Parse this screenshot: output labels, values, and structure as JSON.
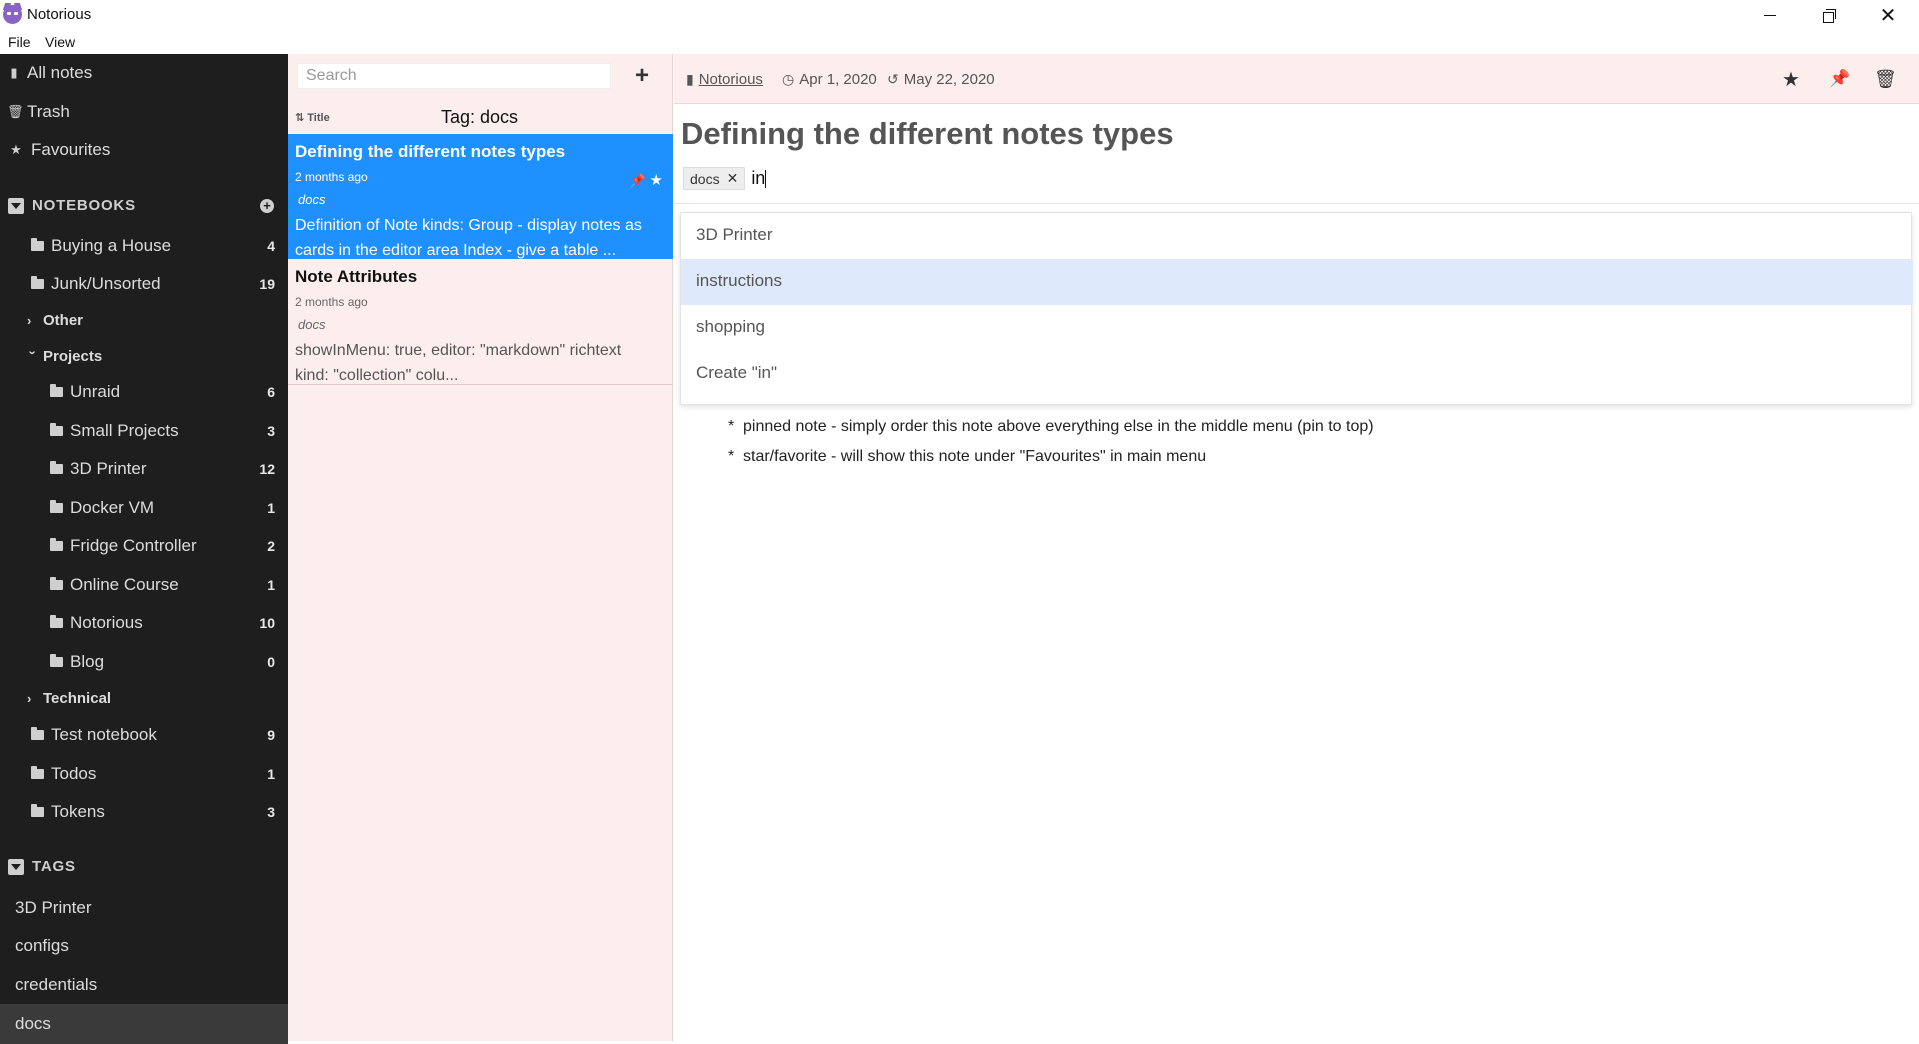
{
  "window": {
    "title": "Notorious"
  },
  "menu": {
    "file": "File",
    "view": "View"
  },
  "sidebar": {
    "all_notes": "All notes",
    "trash": "Trash",
    "favourites": "Favourites",
    "notebooks_header": "NOTEBOOKS",
    "tags_header": "TAGS",
    "notebooks": [
      {
        "label": "Buying a House",
        "count": "4"
      },
      {
        "label": "Junk/Unsorted",
        "count": "19"
      },
      {
        "label": "Other"
      },
      {
        "label": "Projects"
      },
      {
        "label": "Unraid",
        "count": "6"
      },
      {
        "label": "Small Projects",
        "count": "3"
      },
      {
        "label": "3D Printer",
        "count": "12"
      },
      {
        "label": "Docker VM",
        "count": "1"
      },
      {
        "label": "Fridge Controller",
        "count": "2"
      },
      {
        "label": "Online Course",
        "count": "1"
      },
      {
        "label": "Notorious",
        "count": "10"
      },
      {
        "label": "Blog",
        "count": "0"
      },
      {
        "label": "Technical"
      },
      {
        "label": "Test notebook",
        "count": "9"
      },
      {
        "label": "Todos",
        "count": "1"
      },
      {
        "label": "Tokens",
        "count": "3"
      }
    ],
    "tags": [
      "3D Printer",
      "configs",
      "credentials",
      "docs"
    ]
  },
  "notelist": {
    "search_placeholder": "Search",
    "sort_label": "Title",
    "header": "Tag: docs",
    "notes": [
      {
        "title": "Defining the different notes types",
        "date": "2 months ago",
        "tag": "docs",
        "excerpt": "Definition of Note kinds: Group - display notes as cards in the editor area Index - give a table ..."
      },
      {
        "title": "Note Attributes",
        "date": "2 months ago",
        "tag": "docs",
        "excerpt": "showInMenu: true, editor: \"markdown\" richtext kind: \"collection\" colu..."
      }
    ]
  },
  "editor": {
    "notebook": "Notorious",
    "created": "Apr 1, 2020",
    "updated": "May 22, 2020",
    "title": "Defining the different notes types",
    "tag_chip": "docs",
    "tag_input": "in",
    "suggestions": [
      "3D Printer",
      "instructions",
      "shopping",
      "Create \"in\""
    ],
    "highlighted_suggestion": 1,
    "body": [
      "pinned note - simply order this note above everything else in the middle menu (pin to top)",
      "star/favorite  - will show this note under \"Favourites\" in main menu"
    ]
  },
  "colors": {
    "sidebar_bg": "#1e1e1e",
    "notelist_bg": "#fdeeee",
    "selected_note": "#1e90ff",
    "highlight": "#deeafb"
  }
}
